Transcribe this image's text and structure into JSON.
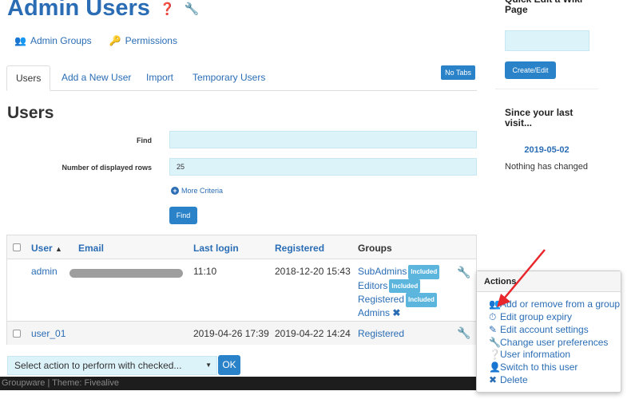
{
  "header": {
    "title": "Admin Users",
    "help_icon": "question-circle-icon",
    "wrench_icon": "wrench-icon"
  },
  "sublinks": [
    {
      "label": "Admin Groups",
      "icon": "users-icon"
    },
    {
      "label": "Permissions",
      "icon": "key-icon"
    }
  ],
  "tabs": [
    {
      "label": "Users"
    },
    {
      "label": "Add a New User"
    },
    {
      "label": "Import"
    },
    {
      "label": "Temporary Users"
    }
  ],
  "no_tabs_label": "No Tabs",
  "section": {
    "heading": "Users"
  },
  "form": {
    "find_label": "Find",
    "find_value": "",
    "rows_label": "Number of displayed rows",
    "rows_value": "25",
    "more_criteria": "More Criteria",
    "find_button": "Find"
  },
  "table": {
    "headers": {
      "user": "User",
      "email": "Email",
      "last_login": "Last login",
      "registered": "Registered",
      "groups": "Groups"
    },
    "rows": [
      {
        "user": "admin",
        "email": "",
        "last_login": "11:10",
        "registered": "2018-12-20 15:43",
        "groups": [
          {
            "name": "SubAdmins",
            "badge": "Included"
          },
          {
            "name": "Editors",
            "badge": "Included"
          },
          {
            "name": "Registered",
            "badge": "Included"
          },
          {
            "name": "Admins",
            "badge": ""
          }
        ]
      },
      {
        "user": "user_01",
        "email": "",
        "last_login": "2019-04-26 17:39",
        "registered": "2019-04-22 14:24",
        "groups": [
          {
            "name": "Registered",
            "badge": ""
          }
        ]
      }
    ]
  },
  "bulk": {
    "select_label": "Select action to perform with checked...",
    "ok_label": "OK"
  },
  "footer": {
    "text": "Groupware | Theme: Fivealive"
  },
  "sidebar": {
    "quick_edit": {
      "title": "Quick Edit a Wiki Page",
      "button": "Create/Edit"
    },
    "last_visit": {
      "title": "Since your last visit...",
      "date": "2019-05-02",
      "message": "Nothing has changed"
    }
  },
  "actions_popup": {
    "title": "Actions",
    "items": [
      {
        "label": "Add or remove from a group",
        "icon": "users-icon"
      },
      {
        "label": "Edit group expiry",
        "icon": "clock-icon"
      },
      {
        "label": "Edit account settings",
        "icon": "edit-icon"
      },
      {
        "label": "Change user preferences",
        "icon": "wrench-icon"
      },
      {
        "label": "User information",
        "icon": "question-circle-icon"
      },
      {
        "label": "Switch to this user",
        "icon": "user-icon"
      },
      {
        "label": "Delete",
        "icon": "delete-icon"
      }
    ]
  },
  "colors": {
    "accent": "#2a6db5",
    "button": "#2a82c9",
    "input_bg": "#ddf3fa",
    "badge": "#5bb5dd",
    "annotation_arrow": "#e8262c"
  }
}
